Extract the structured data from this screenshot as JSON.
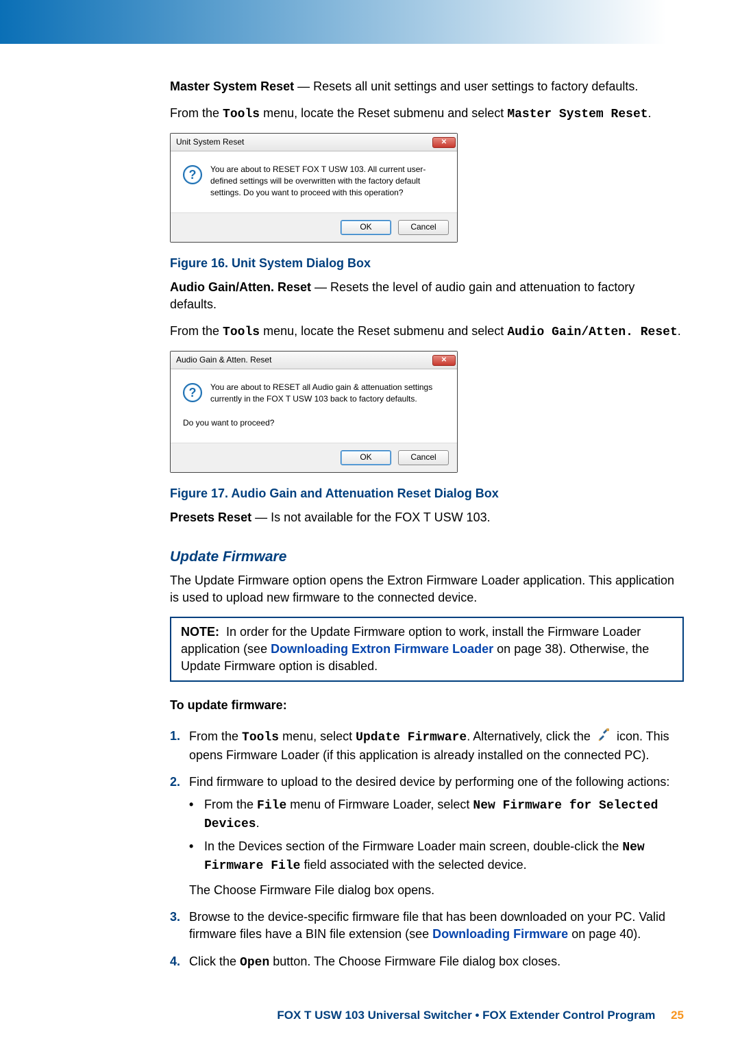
{
  "p1": {
    "head": "Master System Reset",
    "dash": "—",
    "tail": "Resets all unit settings and user settings to factory defaults."
  },
  "p2": {
    "a": "From the",
    "b": "Tools",
    "c": "menu, locate the Reset submenu and select",
    "d": "Master System Reset",
    "e": "."
  },
  "dlg1": {
    "title": "Unit System Reset",
    "msg": "You are about to RESET FOX T USW 103. All current user-defined settings will be overwritten with the factory default settings. Do you want to proceed with this operation?",
    "ok": "OK",
    "cancel": "Cancel"
  },
  "fig16": "Figure 16.  Unit System Dialog Box",
  "p3": {
    "head": "Audio Gain/Atten. Reset",
    "dash": "—",
    "tail": "Resets the level of audio gain and attenuation to factory defaults."
  },
  "p4": {
    "a": "From the",
    "b": "Tools",
    "c": "menu, locate the Reset submenu and select",
    "d": "Audio Gain/Atten. Reset",
    "e": "."
  },
  "dlg2": {
    "title": "Audio Gain & Atten. Reset",
    "msg": "You are about to RESET all Audio gain & attenuation settings currently in the FOX T USW 103 back to factory defaults.",
    "q": "Do you want to proceed?",
    "ok": "OK",
    "cancel": "Cancel"
  },
  "fig17": "Figure 17.  Audio Gain and Attenuation Reset Dialog Box",
  "p5": {
    "head": "Presets Reset",
    "dash": "—",
    "tail": "Is not available for the FOX T USW 103."
  },
  "h_update": "Update Firmware",
  "p6": "The Update Firmware option opens the Extron Firmware Loader application. This application is used to upload new firmware to the connected device.",
  "note": {
    "lead": "NOTE:",
    "a": "In order for the Update Firmware option to work, install the Firmware Loader application (see",
    "link": "Downloading Extron Firmware Loader",
    "b": "on page 38). Otherwise, the Update Firmware option is disabled."
  },
  "subhead": "To update firmware:",
  "step1": {
    "num": "1.",
    "a": "From the",
    "b": "Tools",
    "c": "menu, select",
    "d": "Update Firmware",
    "e": ". Alternatively, click the",
    "f": "icon. This opens Firmware Loader (if this application is already installed on the connected PC)."
  },
  "step2": {
    "num": "2.",
    "text": "Find firmware to upload to the desired device by performing one of the following actions:",
    "b1a": "From the",
    "b1b": "File",
    "b1c": "menu of Firmware Loader, select",
    "b1d": "New Firmware for Selected Devices",
    "b1e": ".",
    "b2a": "In the Devices section of the Firmware Loader main screen, double-click the",
    "b2b": "New Firmware File",
    "b2c": "field associated with the selected device.",
    "after": "The Choose Firmware File dialog box opens."
  },
  "step3": {
    "num": "3.",
    "a": "Browse to the device-specific firmware file that has been downloaded on your PC. Valid firmware files have a BIN file extension (see",
    "link": "Downloading Firmware",
    "b": "on page 40)."
  },
  "step4": {
    "num": "4.",
    "a": "Click the",
    "b": "Open",
    "c": "button. The Choose Firmware File dialog box closes."
  },
  "footer": {
    "text": "FOX T USW 103 Universal Switcher • FOX Extender Control Program",
    "page": "25"
  }
}
